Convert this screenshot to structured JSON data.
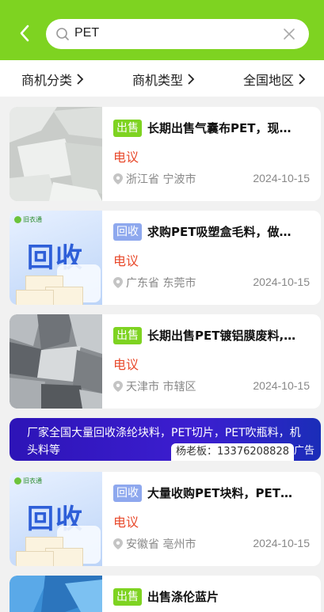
{
  "search": {
    "query": "PET"
  },
  "filters": [
    {
      "label": "商机分类"
    },
    {
      "label": "商机类型"
    },
    {
      "label": "全国地区"
    }
  ],
  "listings": [
    {
      "badge": "出售",
      "badge_type": "sell",
      "title": "长期出售气囊布PET，现…",
      "price": "电议",
      "location": "浙江省 宁波市",
      "date": "2024-10-15"
    },
    {
      "badge": "回收",
      "badge_type": "buy",
      "title": "求购PET吸塑盒毛料，做…",
      "price": "电议",
      "location": "广东省 东莞市",
      "date": "2024-10-15",
      "thumb": {
        "logo": "旧衣通",
        "big": "回收"
      }
    },
    {
      "badge": "出售",
      "badge_type": "sell",
      "title": "长期出售PET镀铝膜废料,…",
      "price": "电议",
      "location": "天津市 市辖区",
      "date": "2024-10-15"
    },
    {
      "badge": "回收",
      "badge_type": "buy",
      "title": "大量收购PET块料，PET…",
      "price": "电议",
      "location": "安徽省 亳州市",
      "date": "2024-10-15",
      "thumb": {
        "logo": "旧衣通",
        "big": "回收"
      }
    },
    {
      "badge": "出售",
      "badge_type": "sell",
      "title": "出售涤伦蓝片"
    }
  ],
  "ad": {
    "text": "厂家全国大量回收涤纶块料，PET切片，PET吹瓶料，机头料等",
    "phone": "杨老板：13376208828",
    "tag": "广告"
  },
  "colors": {
    "brand": "#7ed321",
    "price": "#e84a2c",
    "buy_badge": "#8ea8ee"
  }
}
